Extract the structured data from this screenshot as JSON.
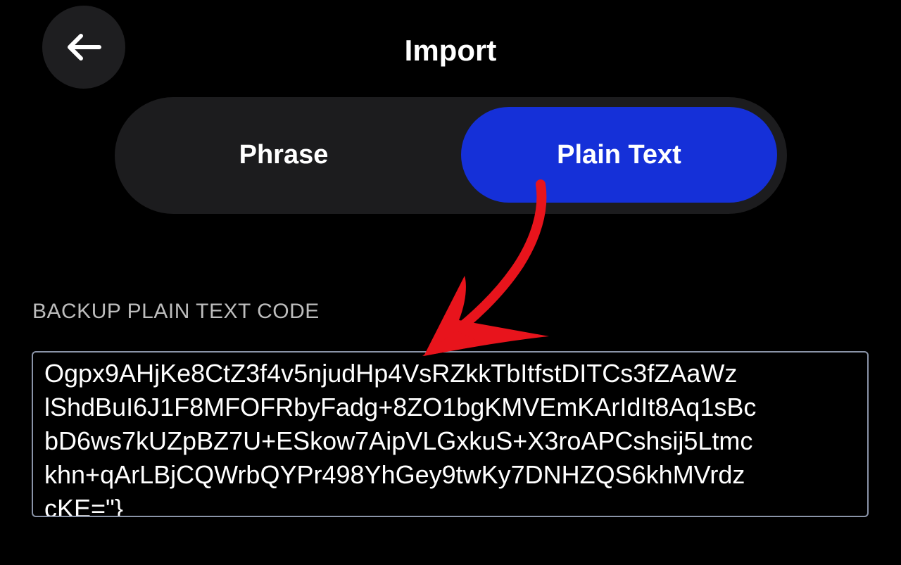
{
  "header": {
    "back_icon": "arrow-left-icon",
    "title": "Import"
  },
  "tabs": [
    {
      "label": "Phrase",
      "selected": false
    },
    {
      "label": "Plain Text",
      "selected": true
    }
  ],
  "colors": {
    "accent": "#1530d8",
    "annotation_arrow": "#e8141c"
  },
  "field": {
    "label": "BACKUP PLAIN TEXT CODE",
    "value": "Ogpx9AHjKe8CtZ3f4v5njudHp4VsRZkkTbItfstDITCs3fZAaWz\nlShdBuI6J1F8MFOFRbyFadg+8ZO1bgKMVEmKArIdIt8Aq1sBc\nbD6ws7kUZpBZ7U+ESkow7AipVLGxkuS+X3roAPCshsij5Ltmc\nkhn+qArLBjCQWrbQYPr498YhGey9twKy7DNHZQS6khMVrdz\ncKE=\"}"
  },
  "annotation": {
    "icon": "red-arrow-annotation"
  }
}
